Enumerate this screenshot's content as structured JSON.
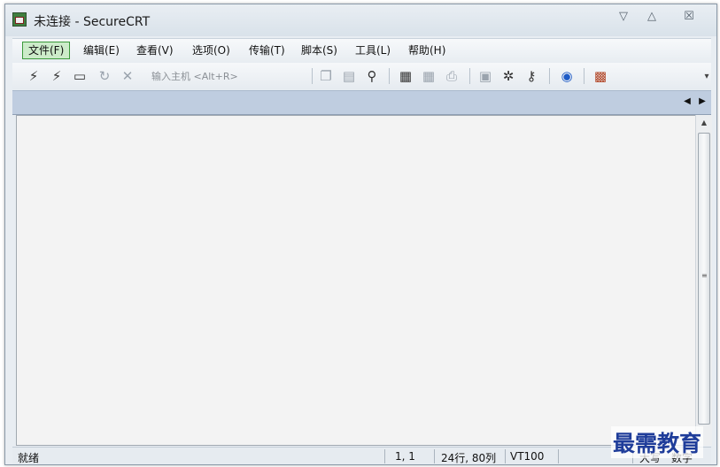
{
  "window": {
    "title": "未连接 - SecureCRT"
  },
  "window_controls": {
    "minimize": "▽",
    "maximize": "△",
    "close": "☒"
  },
  "menu": [
    {
      "label": "文件(F)"
    },
    {
      "label": "编辑(E)"
    },
    {
      "label": "查看(V)"
    },
    {
      "label": "选项(O)"
    },
    {
      "label": "传输(T)"
    },
    {
      "label": "脚本(S)"
    },
    {
      "label": "工具(L)"
    },
    {
      "label": "帮助(H)"
    }
  ],
  "toolbar": {
    "host_placeholder": "输入主机 <Alt+R>",
    "icons": {
      "connect": "connect-icon",
      "quick_connect": "quick-connect-icon",
      "connect_tab": "connect-in-tab-icon",
      "reconnect": "reconnect-icon",
      "disconnect": "disconnect-icon",
      "copy": "copy-icon",
      "paste": "paste-icon",
      "find": "find-icon",
      "print": "print-icon",
      "print_selection": "print-selection-icon",
      "printer": "printer-icon",
      "session_options": "session-options-icon",
      "global_options": "global-options-icon",
      "key": "key-icon",
      "help": "help-icon",
      "keymap": "keymap-icon"
    }
  },
  "tabbar": {
    "left_arrow": "◀",
    "right_arrow": "▶"
  },
  "status": {
    "ready": "就绪",
    "cursor": "1,  1",
    "size": "24行, 80列",
    "emulation": "VT100",
    "caps": "大写",
    "num": "数字"
  },
  "watermark": "最需教育",
  "colors": {
    "menu_active_bg": "#ccebc9",
    "menu_active_border": "#3b9a3b",
    "tabbar_bg": "#bfcde0",
    "watermark": "#1f3d9a"
  }
}
